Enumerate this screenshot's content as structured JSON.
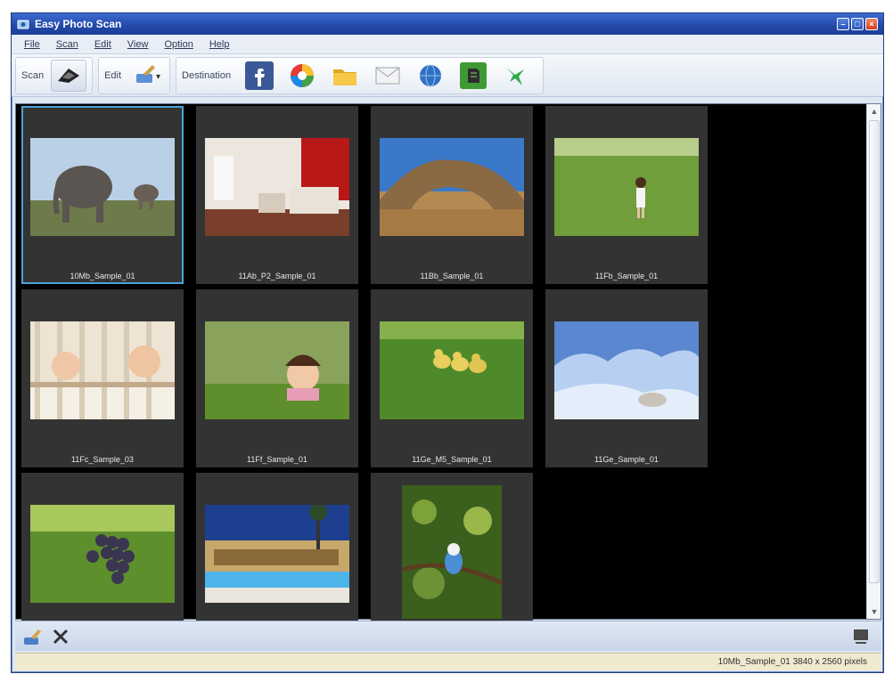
{
  "window": {
    "title": "Easy Photo Scan"
  },
  "menu": {
    "items": [
      "File",
      "Scan",
      "Edit",
      "View",
      "Option",
      "Help"
    ]
  },
  "toolbar": {
    "scan_label": "Scan",
    "edit_label": "Edit",
    "destination_label": "Destination",
    "destinations": [
      "facebook",
      "picasa",
      "folder",
      "mail",
      "web",
      "evernote",
      "hummingbird"
    ]
  },
  "thumbnails": [
    {
      "caption": "10Mb_Sample_01",
      "subject": "elephants",
      "selected": true
    },
    {
      "caption": "11Ab_P2_Sample_01",
      "subject": "bedroom",
      "selected": false
    },
    {
      "caption": "11Bb_Sample_01",
      "subject": "rock-arch",
      "selected": false
    },
    {
      "caption": "11Fb_Sample_01",
      "subject": "girl-on-grass",
      "selected": false
    },
    {
      "caption": "11Fc_Sample_03",
      "subject": "babies-in-crib",
      "selected": false
    },
    {
      "caption": "11Ff_Sample_01",
      "subject": "girl-in-grass",
      "selected": false
    },
    {
      "caption": "11Ge_M5_Sample_01",
      "subject": "ducklings",
      "selected": false
    },
    {
      "caption": "11Ge_Sample_01",
      "subject": "seal-on-ice",
      "selected": false
    },
    {
      "caption": "",
      "subject": "grapes",
      "selected": false
    },
    {
      "caption": "",
      "subject": "hotel-pool",
      "selected": false
    },
    {
      "caption": "",
      "subject": "kingfisher",
      "selected": false
    }
  ],
  "status": {
    "text": "10Mb_Sample_01 3840 x 2560 pixels"
  },
  "colors": {
    "title_bar": "#2248a8",
    "selection": "#4aa3d9",
    "thumb_bg": "#333333",
    "status_bg": "#efe9cf"
  }
}
